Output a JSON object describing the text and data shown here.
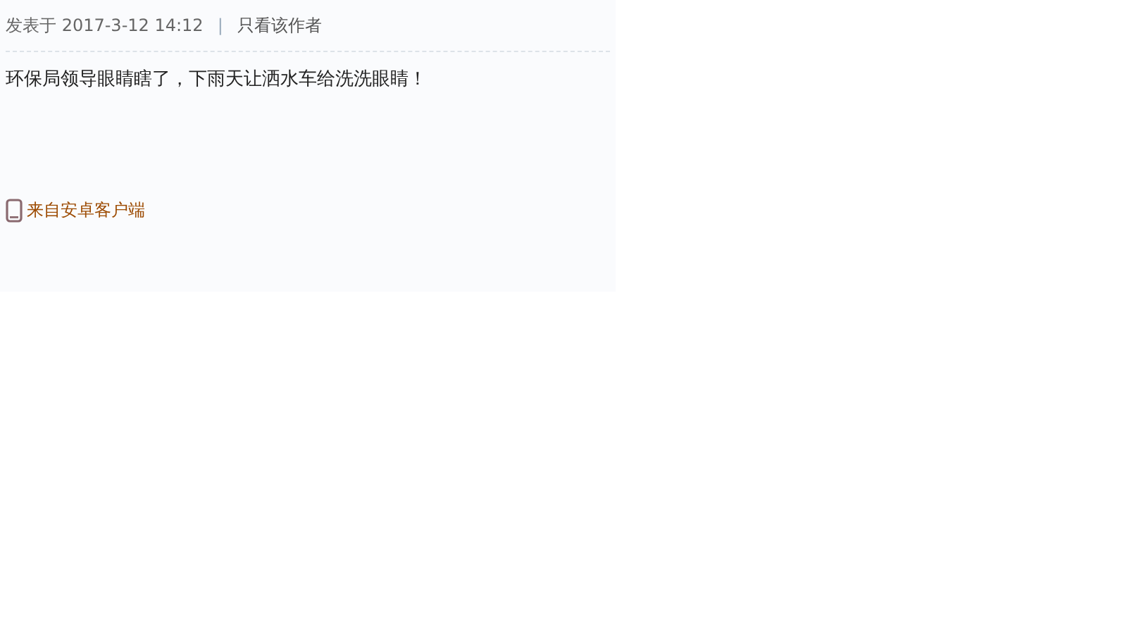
{
  "post": {
    "posted_label": "发表于",
    "date": "2017-3-12 14:12",
    "separator": "|",
    "author_only_link": "只看该作者",
    "body": "环保局领导眼睛瞎了，下雨天让洒水车给洗洗眼睛！",
    "source": "来自安卓客户端"
  }
}
